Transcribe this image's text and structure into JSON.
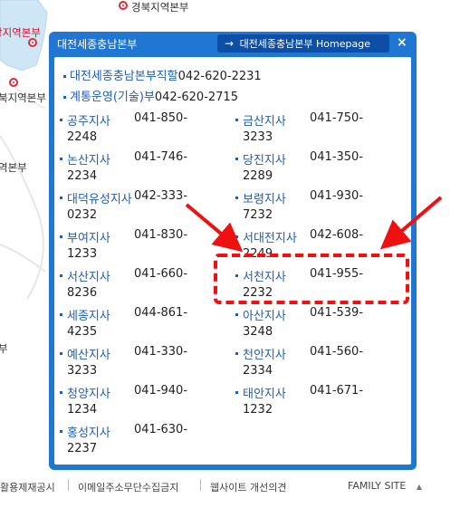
{
  "map": {
    "labels": {
      "gyeongbuk": "경북지역본부",
      "left_top": "강지역본부",
      "left_mid": "북지역본부",
      "left_low": "역본부",
      "left_bottom": "부"
    },
    "colors": {
      "region_fill": "#cfe6f6",
      "road": "#e2e2e2",
      "marker": "#e0293a"
    }
  },
  "popup": {
    "title": "대전세종충남본부",
    "homepage_label": "대전세종충남본부 Homepage",
    "homepage_arrow": "→",
    "close_label": "×",
    "header_rows": [
      {
        "name": "대전세종충남본부직할",
        "phone": "042-620-2231"
      },
      {
        "name": "계통운영(기술)부",
        "phone": "042-620-2715"
      }
    ],
    "branches": [
      {
        "name": "공주지사",
        "phone_a": "041-850-",
        "phone_b": "2248"
      },
      {
        "name": "금산지사",
        "phone_a": "041-750-",
        "phone_b": "3233"
      },
      {
        "name": "논산지사",
        "phone_a": "041-746-",
        "phone_b": "2234"
      },
      {
        "name": "당진지사",
        "phone_a": "041-350-",
        "phone_b": "2289"
      },
      {
        "name": "대덕유성지사",
        "phone_a": "042-333-",
        "phone_b": "0232"
      },
      {
        "name": "보령지사",
        "phone_a": "041-930-",
        "phone_b": "7232"
      },
      {
        "name": "부여지사",
        "phone_a": "041-830-",
        "phone_b": "1233"
      },
      {
        "name": "서대전지사",
        "phone_a": "042-608-",
        "phone_b": "2249"
      },
      {
        "name": "서산지사",
        "phone_a": "041-660-",
        "phone_b": "8236"
      },
      {
        "name": "서천지사",
        "phone_a": "041-955-",
        "phone_b": "2232"
      },
      {
        "name": "세종지사",
        "phone_a": "044-861-",
        "phone_b": "4235"
      },
      {
        "name": "아산지사",
        "phone_a": "041-539-",
        "phone_b": "3248"
      },
      {
        "name": "예산지사",
        "phone_a": "041-330-",
        "phone_b": "3233"
      },
      {
        "name": "천안지사",
        "phone_a": "041-560-",
        "phone_b": "2334"
      },
      {
        "name": "청양지사",
        "phone_a": "041-940-",
        "phone_b": "1234"
      },
      {
        "name": "태안지사",
        "phone_a": "041-671-",
        "phone_b": "1232"
      },
      {
        "name": "홍성지사",
        "phone_a": "041-630-",
        "phone_b": "2237"
      }
    ],
    "highlighted_branch": "서천지사",
    "annotation_color": "#ee1111"
  },
  "footer": {
    "links": [
      "활용제재공시",
      "이메일주소무단수집금지",
      "웹사이트 개선의견"
    ],
    "family_site": "FAMILY SITE",
    "family_arrow": "▲"
  }
}
